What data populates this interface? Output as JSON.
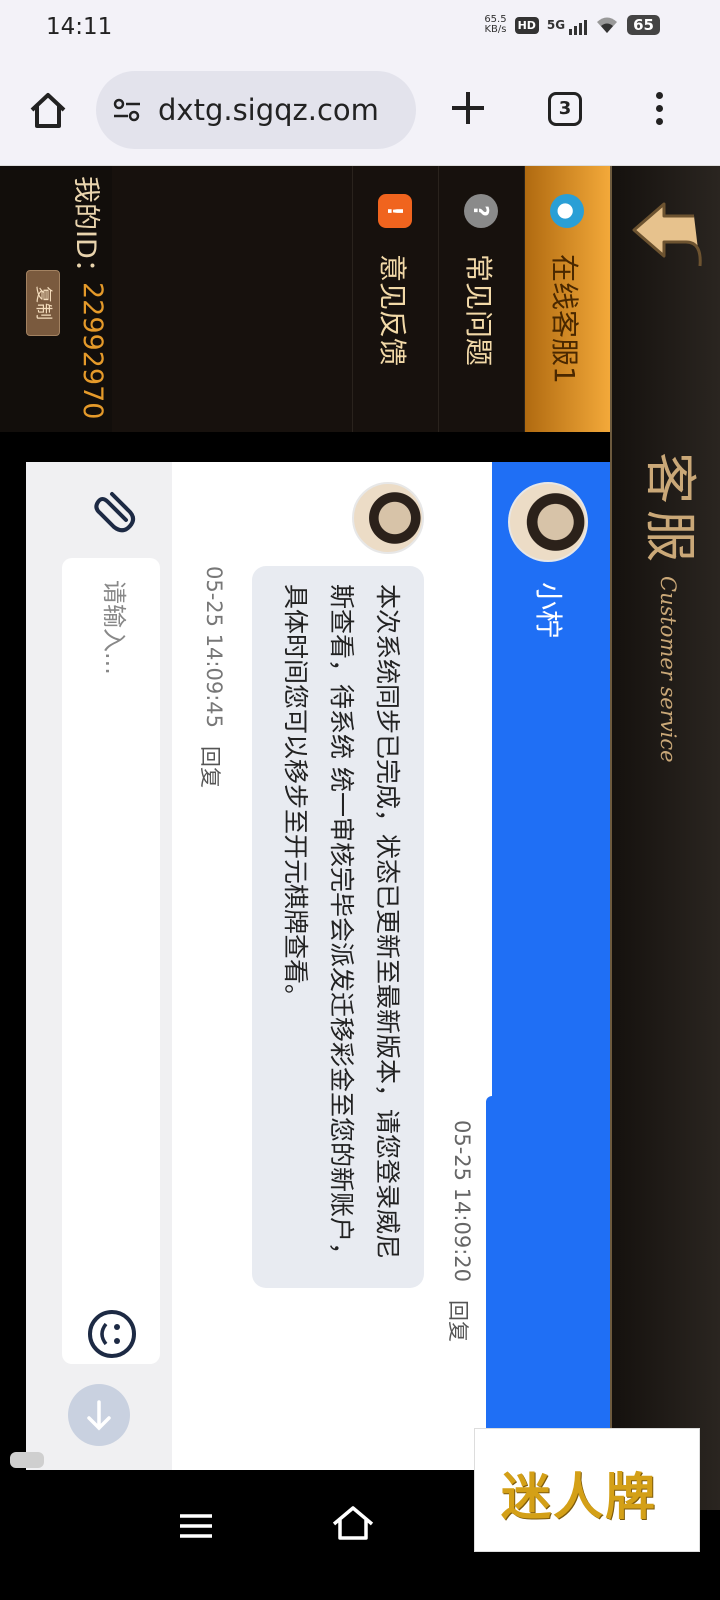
{
  "status_bar": {
    "time": "14:11",
    "net_speed_value": "65.5",
    "net_speed_unit": "KB/s",
    "hd_badge": "HD",
    "network": "5G",
    "battery": "65"
  },
  "browser": {
    "url": "dxtg.sigqz.com",
    "tab_count": "3"
  },
  "app": {
    "header_cn": "客服",
    "header_en": "Customer service",
    "menu": [
      {
        "label": "在线客服1",
        "icon": "agent-icon",
        "active": true
      },
      {
        "label": "常见问题",
        "icon": "question-icon",
        "active": false
      },
      {
        "label": "意见反馈",
        "icon": "feedback-icon",
        "active": false
      }
    ],
    "my_id_label": "我的ID：",
    "my_id_value": "22992970",
    "copy_label": "复制"
  },
  "chat": {
    "agent_name": "小柠",
    "messages": [
      {
        "text": "本次系统同步已完成，状态已更新至最新版本，请您登录威尼斯查看，待系统 统一审核完毕会派发迁移彩金至您的新账户，具体时间您可以移步至开元棋牌查看。",
        "time": "05-25 14:09:45",
        "reply": "回复"
      },
      {
        "time": "05-25 14:09:20",
        "reply": "回复"
      }
    ],
    "input_placeholder": "请输入..."
  },
  "overlay": {
    "logo_text": "迷人牌"
  },
  "colors": {
    "accent_blue": "#1f6ff5",
    "menu_active": "#f3a93a",
    "gold": "#caa878"
  }
}
